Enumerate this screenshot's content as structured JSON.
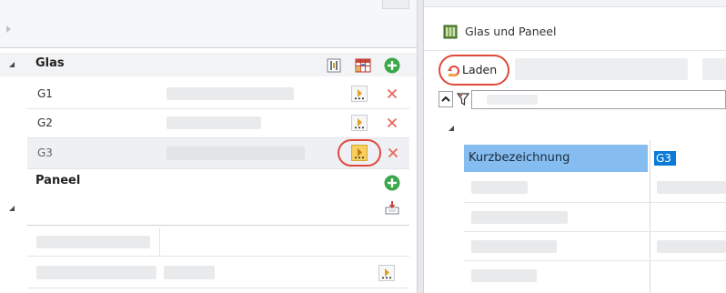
{
  "left_panel": {
    "glas": {
      "label": "Glas",
      "rows": [
        {
          "name": "G1"
        },
        {
          "name": "G2"
        },
        {
          "name": "G3"
        }
      ]
    },
    "paneel": {
      "label": "Paneel"
    }
  },
  "right_panel": {
    "title": "Glas und Paneel",
    "load_label": "Laden",
    "property": {
      "label": "Kurzbezeichnung",
      "value": "G3"
    }
  },
  "colors": {
    "accent_red": "#e0483c",
    "highlight_blue": "#86bdf0",
    "selection_blue": "#0a7ad6",
    "add_green": "#3aa84a",
    "delete_red": "#e8685c"
  }
}
